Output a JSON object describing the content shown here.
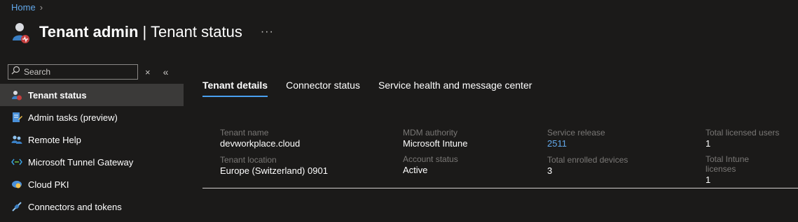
{
  "breadcrumb": {
    "home": "Home"
  },
  "header": {
    "title_main": "Tenant admin",
    "title_sep": "|",
    "title_sub": "Tenant status",
    "more": "···"
  },
  "sidebar": {
    "search_placeholder": "Search",
    "clear": "×",
    "collapse": "«",
    "items": [
      {
        "label": "Tenant status",
        "icon": "tenant-status-icon"
      },
      {
        "label": "Admin tasks (preview)",
        "icon": "admin-tasks-icon"
      },
      {
        "label": "Remote Help",
        "icon": "remote-help-icon"
      },
      {
        "label": "Microsoft Tunnel Gateway",
        "icon": "tunnel-gateway-icon"
      },
      {
        "label": "Cloud PKI",
        "icon": "cloud-pki-icon"
      },
      {
        "label": "Connectors and tokens",
        "icon": "connectors-icon"
      }
    ]
  },
  "tabs": [
    "Tenant details",
    "Connector status",
    "Service health and message center"
  ],
  "details": {
    "tenant_name_label": "Tenant name",
    "tenant_name": "devworkplace.cloud",
    "tenant_location_label": "Tenant location",
    "tenant_location": "Europe (Switzerland) 0901",
    "mdm_authority_label": "MDM authority",
    "mdm_authority": "Microsoft Intune",
    "account_status_label": "Account status",
    "account_status": "Active",
    "service_release_label": "Service release",
    "service_release": "2511",
    "total_enrolled_label": "Total enrolled devices",
    "total_enrolled": "3",
    "total_licensed_label": "Total licensed users",
    "total_licensed": "1",
    "total_intune_label": "Total Intune licenses",
    "total_intune": "1"
  },
  "colors": {
    "background": "#1b1a19",
    "accent": "#4aa0f0",
    "link": "#62a8ea",
    "active_nav": "#3b3a39"
  }
}
